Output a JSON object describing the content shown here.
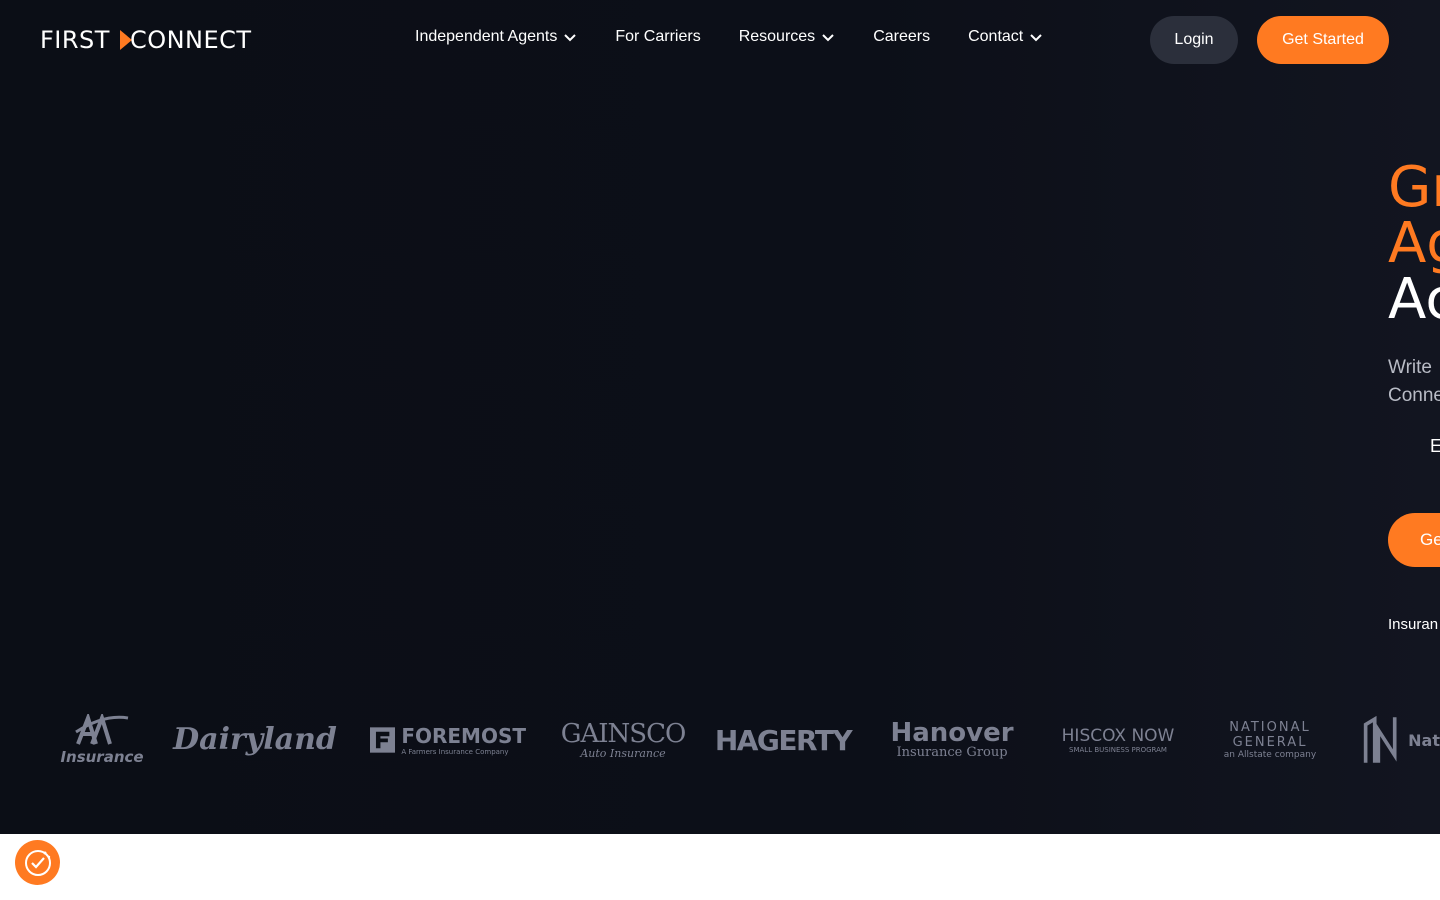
{
  "brand": {
    "logo_left": "FIRST",
    "logo_right": "CONNECT",
    "accent": "#ff7a21",
    "background": "#0b0e16"
  },
  "nav": {
    "items": [
      {
        "label": "Independent Agents",
        "dropdown": true
      },
      {
        "label": "For Carriers",
        "dropdown": false
      },
      {
        "label": "Resources",
        "dropdown": true
      },
      {
        "label": "Careers",
        "dropdown": false
      },
      {
        "label": "Contact",
        "dropdown": true
      }
    ],
    "login_label": "Login",
    "get_started_label": "Get Started"
  },
  "hero": {
    "headline_line1": "Gr",
    "headline_line2": "Ag",
    "headline_line3": "Ac",
    "subtext_line1": "Write",
    "subtext_line2": "Conne",
    "secondary": "E",
    "cta_label": "Ge",
    "trust_text": "Insuran"
  },
  "carriers": [
    {
      "main": "Insurance",
      "sub": ""
    },
    {
      "main": "Dairyland",
      "sub": ""
    },
    {
      "main": "FOREMOST",
      "sub": "A Farmers Insurance Company"
    },
    {
      "main": "GAINSCO",
      "sub": "Auto Insurance"
    },
    {
      "main": "HAGERTY",
      "sub": ""
    },
    {
      "main": "Hanover",
      "sub": "Insurance Group"
    },
    {
      "main": "HISCOX NOW",
      "sub": "SMALL BUSINESS PROGRAM"
    },
    {
      "main": "NATIONAL GENERAL",
      "sub": "an Allstate company"
    },
    {
      "main": "Nat",
      "sub": ""
    }
  ],
  "icons": {
    "chevron": "chevron-down-icon",
    "cookie": "cookie-consent-icon"
  }
}
